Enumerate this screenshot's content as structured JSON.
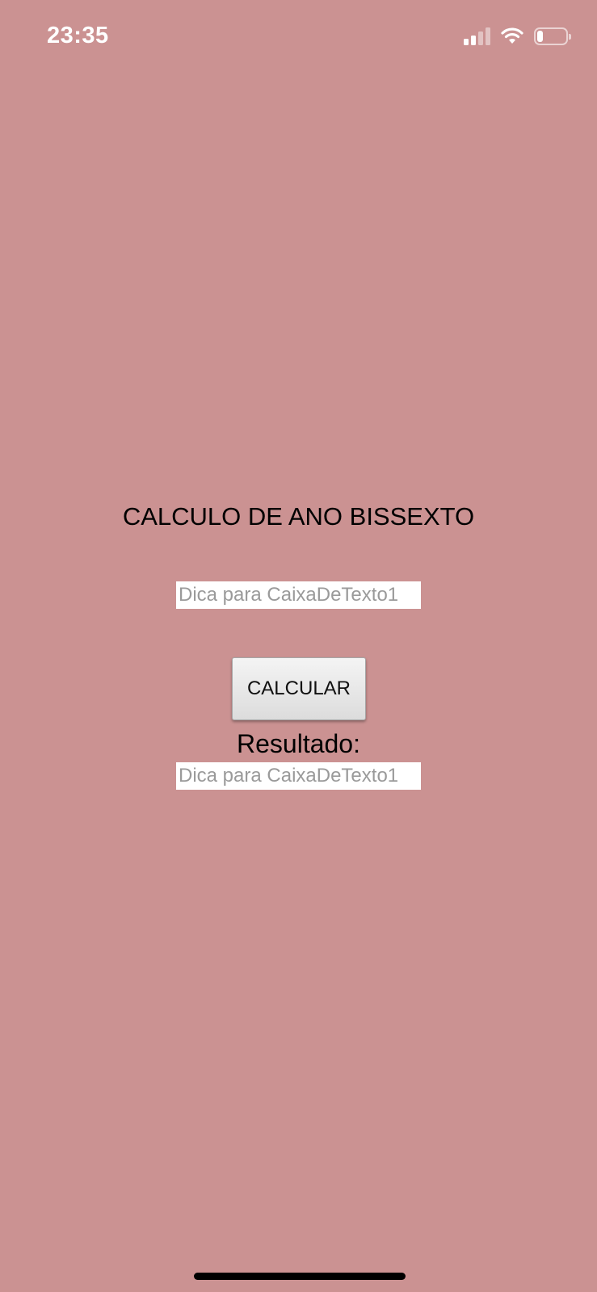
{
  "status_bar": {
    "time": "23:35",
    "signal_icon": "cellular-signal-icon",
    "wifi_icon": "wifi-icon",
    "battery_icon": "battery-icon",
    "battery_level": 0.2
  },
  "colors": {
    "background": "#cb9292"
  },
  "main": {
    "title": "CALCULO DE ANO BISSEXTO",
    "year_input": {
      "value": "",
      "placeholder": "Dica para CaixaDeTexto1"
    },
    "calculate_label": "CALCULAR",
    "result_label": "Resultado:",
    "result_input": {
      "value": "",
      "placeholder": "Dica para CaixaDeTexto1"
    }
  }
}
